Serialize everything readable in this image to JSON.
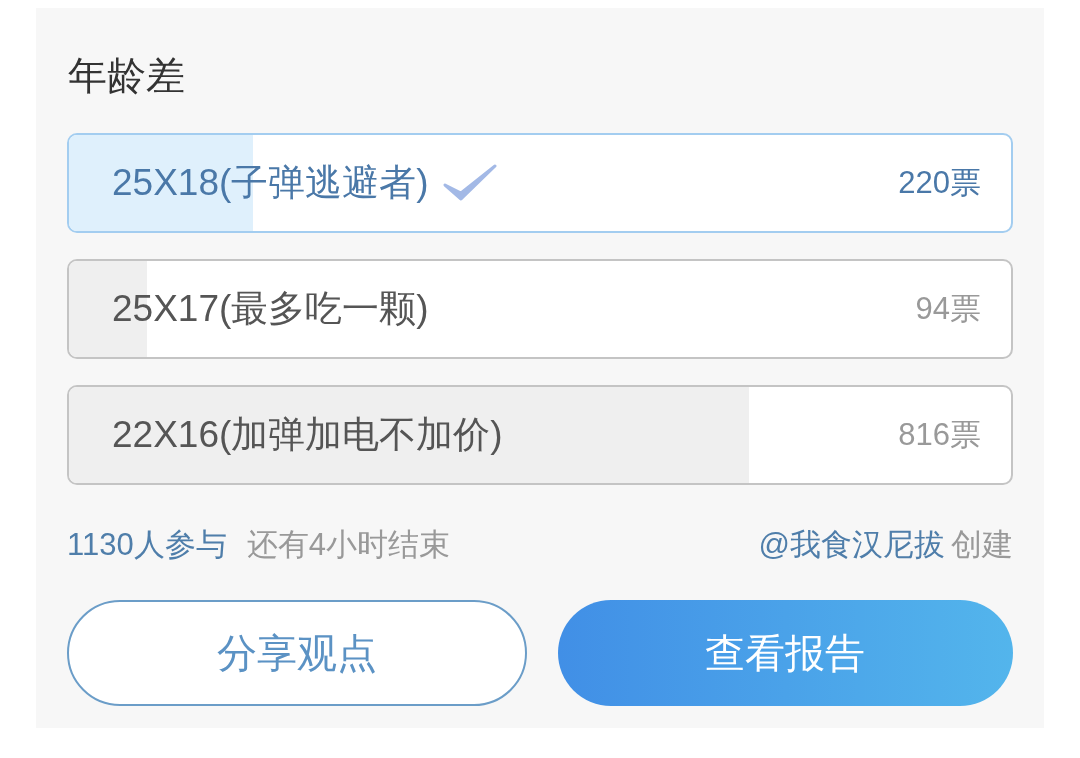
{
  "poll": {
    "title": "年龄差",
    "options": [
      {
        "label": "25X18(子弹逃避者)",
        "votes": "220票",
        "level": 0.195,
        "selected": true
      },
      {
        "label": "25X17(最多吃一颗)",
        "votes": "94票",
        "level": 0.083,
        "selected": false
      },
      {
        "label": "22X16(加弹加电不加价)",
        "votes": "816票",
        "level": 0.722,
        "selected": false
      }
    ],
    "participants": "1130人参与",
    "time_left": "还有4小时结束",
    "creator": "@我食汉尼拔",
    "creator_suffix": "创建",
    "buttons": [
      {
        "label": "分享观点",
        "kind": "outline"
      },
      {
        "label": "查看报告",
        "kind": "primary"
      }
    ]
  }
}
